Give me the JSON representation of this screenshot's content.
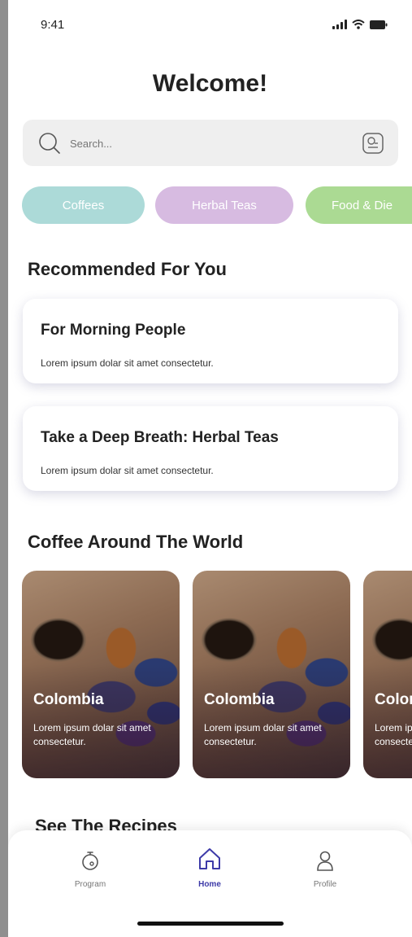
{
  "status_bar": {
    "time": "9:41"
  },
  "header": {
    "title": "Welcome!"
  },
  "search": {
    "placeholder": "Search..."
  },
  "categories": [
    {
      "label": "Coffees",
      "color": "#a8d9d6"
    },
    {
      "label": "Herbal Teas",
      "color": "#d5b8e0"
    },
    {
      "label": "Food & Die",
      "color": "#a7d98e"
    }
  ],
  "recommended": {
    "title": "Recommended For You",
    "cards": [
      {
        "title": "For Morning People",
        "desc": "Lorem ipsum dolar sit amet consectetur."
      },
      {
        "title": "Take a Deep Breath: Herbal Teas",
        "desc": "Lorem ipsum dolar sit amet consectetur."
      }
    ]
  },
  "world": {
    "title": "Coffee Around The World",
    "tiles": [
      {
        "title": "Colombia",
        "desc": "Lorem ipsum dolar sit amet consectetur."
      },
      {
        "title": "Colombia",
        "desc": "Lorem ipsum dolar sit amet consectetur."
      },
      {
        "title": "Colombia",
        "desc": "Lorem ipsum dolar sit amet consectetur."
      }
    ]
  },
  "recipes": {
    "title": "See The Recipes"
  },
  "tabbar": {
    "tabs": [
      {
        "label": "Program",
        "icon": "timer-icon"
      },
      {
        "label": "Home",
        "icon": "home-icon",
        "active": true
      },
      {
        "label": "Profile",
        "icon": "user-icon"
      }
    ],
    "accent": "#3d3aa8"
  }
}
